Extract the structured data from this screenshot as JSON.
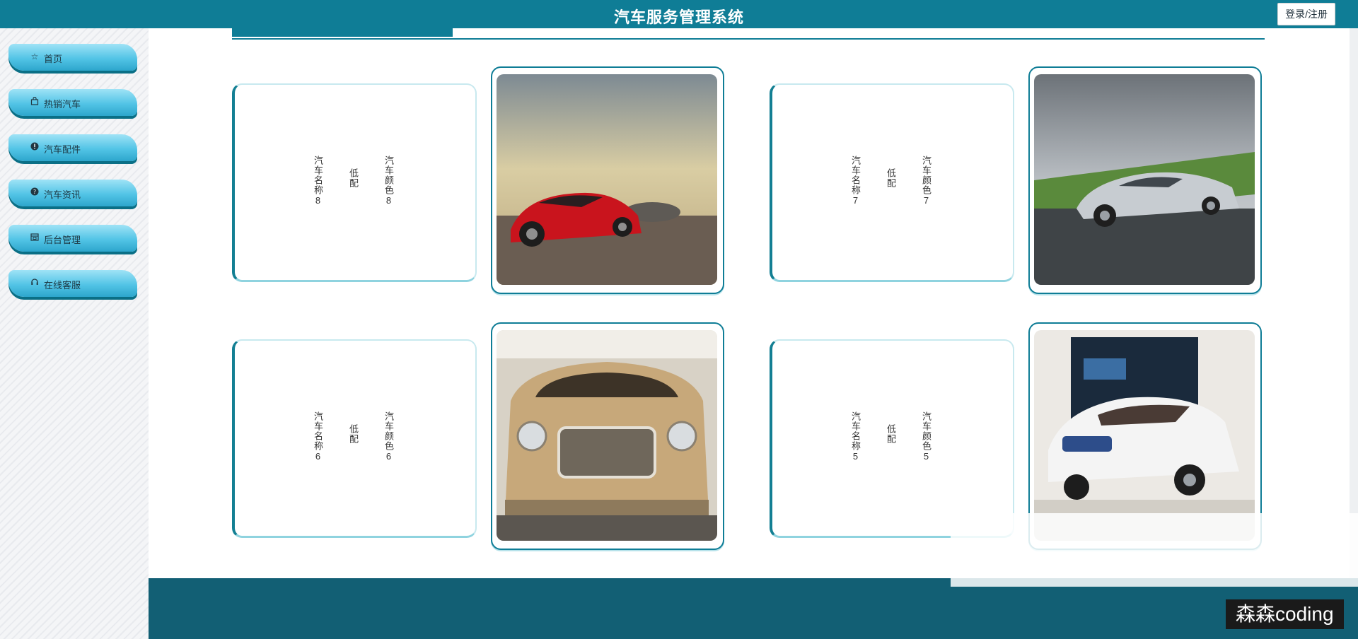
{
  "header": {
    "title": "汽车服务管理系统",
    "login_label": "登录/注册"
  },
  "sidebar": {
    "items": [
      {
        "label": "首页",
        "icon": "star-icon"
      },
      {
        "label": "热销汽车",
        "icon": "bag-icon"
      },
      {
        "label": "汽车配件",
        "icon": "alert-icon"
      },
      {
        "label": "汽车资讯",
        "icon": "help-icon"
      },
      {
        "label": "后台管理",
        "icon": "calendar-icon"
      },
      {
        "label": "在线客服",
        "icon": "headset-icon"
      }
    ]
  },
  "cars": [
    {
      "name": "汽车名称8",
      "trim": "低配",
      "color": "汽车颜色8",
      "photo": "red-sports-car"
    },
    {
      "name": "汽车名称7",
      "trim": "低配",
      "color": "汽车颜色7",
      "photo": "silver-concept-car"
    },
    {
      "name": "汽车名称6",
      "trim": "低配",
      "color": "汽车颜色6",
      "photo": "gold-luxury-suv"
    },
    {
      "name": "汽车名称5",
      "trim": "低配",
      "color": "汽车颜色5",
      "photo": "white-electric-suv"
    }
  ],
  "watermark": "森森coding",
  "colors": {
    "primary": "#0f7d96",
    "footer": "#125f74",
    "nav_gradient_top": "#9fe3f6",
    "nav_gradient_bottom": "#2da6cc"
  }
}
